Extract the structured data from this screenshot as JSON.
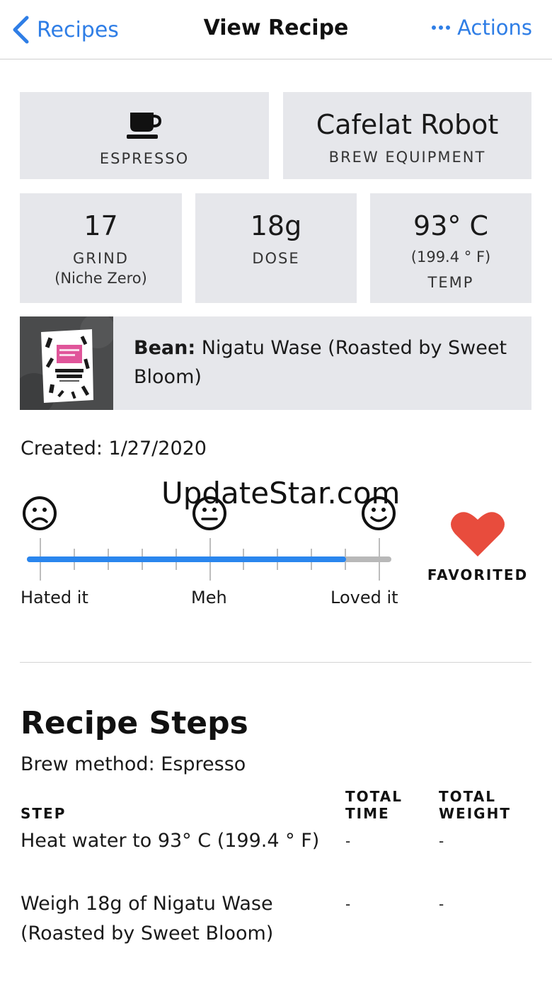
{
  "nav": {
    "back_label": "Recipes",
    "title": "View Recipe",
    "actions_label": "Actions"
  },
  "tiles": {
    "method": {
      "label": "ESPRESSO",
      "icon": "coffee-cup-icon"
    },
    "equipment": {
      "value": "Cafelat Robot",
      "label": "BREW EQUIPMENT"
    },
    "grind": {
      "value": "17",
      "label": "GRIND",
      "sub": "(Niche Zero)"
    },
    "dose": {
      "value": "18g",
      "label": "DOSE"
    },
    "temp": {
      "value": "93° C",
      "sub": "(199.4 ° F)",
      "label": "TEMP"
    }
  },
  "bean": {
    "prefix": "Bean:",
    "name": "Nigatu Wase (Roasted by Sweet Bloom)"
  },
  "created": "Created: 1/27/2020",
  "watermark": "UpdateStar.com",
  "rating": {
    "labels": [
      "Hated it",
      "Meh",
      "Loved it"
    ],
    "value_fraction": 0.875,
    "ticks": 11,
    "icons": [
      "sad-face-icon",
      "neutral-face-icon",
      "happy-face-icon"
    ]
  },
  "favorite": {
    "label": "FAVORITED",
    "icon": "heart-icon",
    "color": "#e84c3d"
  },
  "steps": {
    "title": "Recipe Steps",
    "brew_method": "Brew method: Espresso",
    "headers": {
      "step": "STEP",
      "time_line1": "TOTAL",
      "time_line2": "TIME",
      "weight_line1": "TOTAL",
      "weight_line2": "WEIGHT"
    },
    "rows": [
      {
        "step": "Heat water to 93° C (199.4 ° F)",
        "time": "-",
        "weight": "-"
      },
      {
        "step_line1": "Weigh 18g of Nigatu Wase",
        "step_line2": "(Roasted by Sweet Bloom)",
        "time": "-",
        "weight": "-"
      }
    ]
  },
  "colors": {
    "accent": "#2f7ee6",
    "slider": "#2a86ee",
    "tile_bg": "#e6e7eb"
  }
}
